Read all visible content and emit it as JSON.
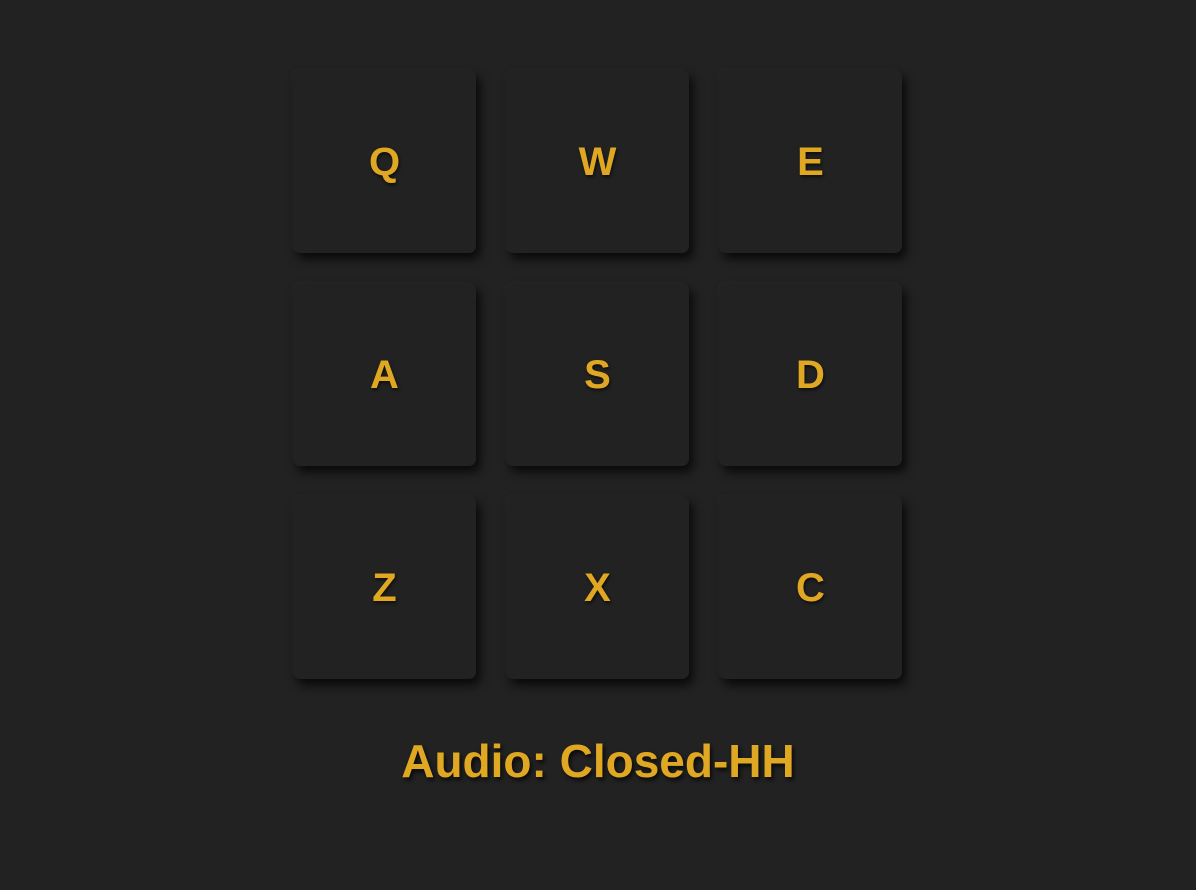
{
  "colors": {
    "background": "#222222",
    "pad": "#222222",
    "accent": "#e0a822"
  },
  "pads": [
    {
      "label": "Q"
    },
    {
      "label": "W"
    },
    {
      "label": "E"
    },
    {
      "label": "A"
    },
    {
      "label": "S"
    },
    {
      "label": "D"
    },
    {
      "label": "Z"
    },
    {
      "label": "X"
    },
    {
      "label": "C"
    }
  ],
  "display": {
    "text": "Audio: Closed-HH"
  }
}
